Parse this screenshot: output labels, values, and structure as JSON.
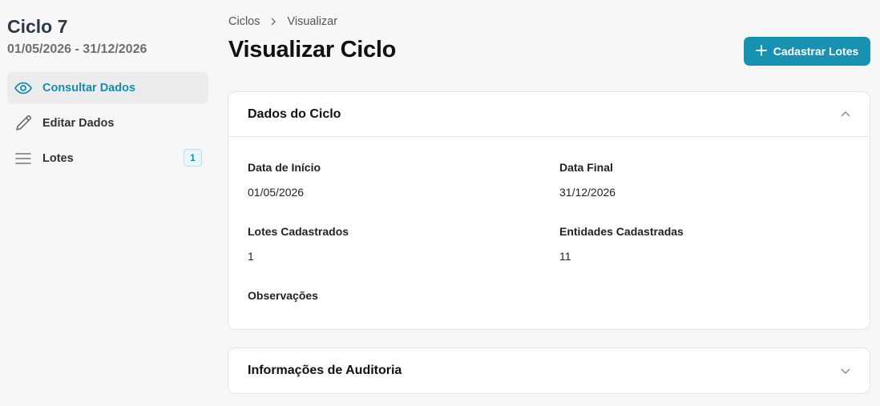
{
  "sidebar": {
    "title": "Ciclo 7",
    "dates": "01/05/2026 - 31/12/2026",
    "items": [
      {
        "label": "Consultar Dados",
        "icon": "eye-icon",
        "active": true
      },
      {
        "label": "Editar Dados",
        "icon": "pencil-icon",
        "active": false
      },
      {
        "label": "Lotes",
        "icon": "list-icon",
        "active": false,
        "badge": "1"
      }
    ]
  },
  "breadcrumb": {
    "parent": "Ciclos",
    "current": "Visualizar"
  },
  "page": {
    "title": "Visualizar Ciclo"
  },
  "actions": {
    "register_lots": "Cadastrar Lotes"
  },
  "card_cycle": {
    "title": "Dados do Ciclo",
    "fields": {
      "start_label": "Data de Início",
      "start_value": "01/05/2026",
      "end_label": "Data Final",
      "end_value": "31/12/2026",
      "lots_label": "Lotes Cadastrados",
      "lots_value": "1",
      "entities_label": "Entidades Cadastradas",
      "entities_value": "11",
      "notes_label": "Observações",
      "notes_value": ""
    }
  },
  "card_audit": {
    "title": "Informações de Auditoria"
  },
  "colors": {
    "accent": "#1991b0",
    "active_text": "#1b8aa6",
    "active_bg": "#ececee"
  }
}
